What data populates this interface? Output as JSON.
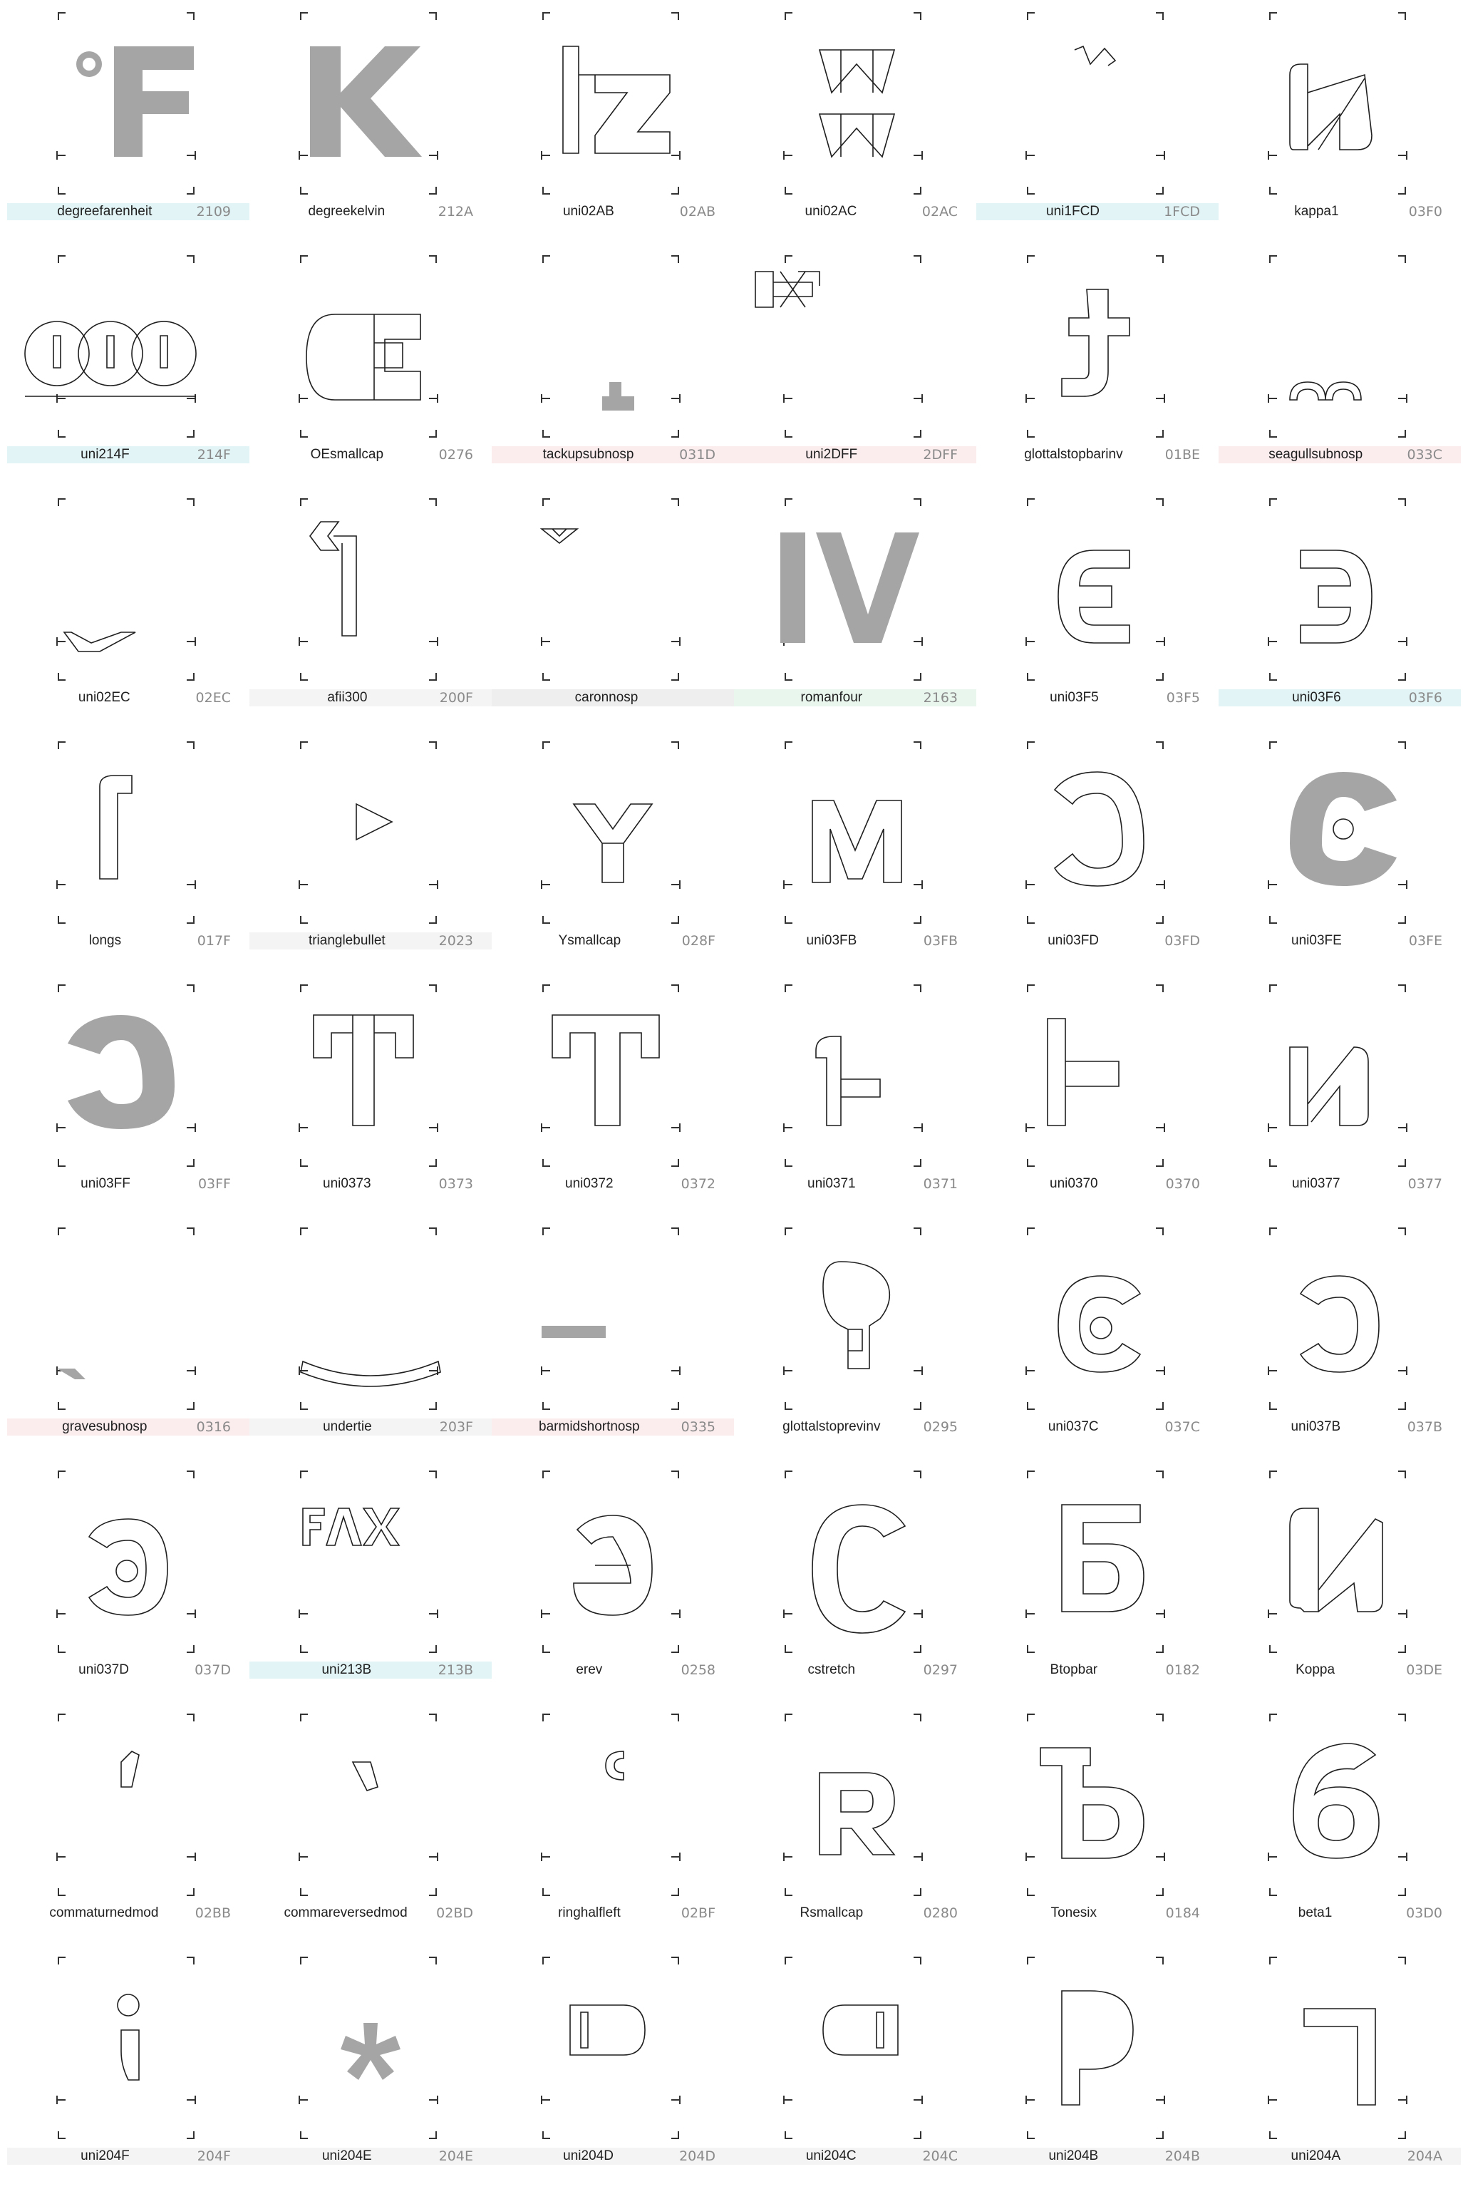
{
  "view": {
    "title": "",
    "accent": "#a5a5a5"
  },
  "colors": {
    "blue": "#e2f4f6",
    "pink": "#fbecee",
    "gray": "#eeeeee",
    "lgray": "#f4f4f4",
    "green": "#e9f6ee",
    "fill_glyph": "#a5a5a5",
    "outline": "#1f1f1f"
  },
  "glyphs": [
    {
      "name": "degreefarenheit",
      "code": "2109",
      "bar": "blue",
      "kind": "fill-F"
    },
    {
      "name": "degreekelvin",
      "code": "212A",
      "bar": "",
      "kind": "fill-K"
    },
    {
      "name": "uni02AB",
      "code": "02AB",
      "bar": "",
      "kind": "outline-lz"
    },
    {
      "name": "uni02AC",
      "code": "02AC",
      "bar": "",
      "kind": "outline-ww"
    },
    {
      "name": "uni1FCD",
      "code": "1FCD",
      "bar": "blue",
      "kind": "outline-accent"
    },
    {
      "name": "kappa1",
      "code": "03F0",
      "bar": "",
      "kind": "outline-kappa"
    },
    {
      "name": "uni214F",
      "code": "214F",
      "bar": "blue",
      "kind": "outline-000"
    },
    {
      "name": "OEsmallcap",
      "code": "0276",
      "bar": "",
      "kind": "outline-oe"
    },
    {
      "name": "tackupsubnosp",
      "code": "031D",
      "bar": "pink",
      "kind": "fill-tack"
    },
    {
      "name": "uni2DFF",
      "code": "2DFF",
      "bar": "pink",
      "kind": "outline-ligature"
    },
    {
      "name": "glottalstopbarinv",
      "code": "01BE",
      "bar": "",
      "kind": "outline-glottalinv"
    },
    {
      "name": "seagullsubnosp",
      "code": "033C",
      "bar": "pink",
      "kind": "outline-seagull"
    },
    {
      "name": "uni02EC",
      "code": "02EC",
      "bar": "",
      "kind": "outline-vlow"
    },
    {
      "name": "afii300",
      "code": "200F",
      "bar": "lgray",
      "kind": "outline-arrowflag"
    },
    {
      "name": "caronnosp",
      "code": "",
      "bar": "gray",
      "kind": "outline-caron"
    },
    {
      "name": "romanfour",
      "code": "2163",
      "bar": "green",
      "kind": "fill-IV"
    },
    {
      "name": "uni03F5",
      "code": "03F5",
      "bar": "",
      "kind": "outline-epsilon"
    },
    {
      "name": "uni03F6",
      "code": "03F6",
      "bar": "blue",
      "kind": "outline-revepsilon"
    },
    {
      "name": "longs",
      "code": "017F",
      "bar": "",
      "kind": "outline-longs"
    },
    {
      "name": "trianglebullet",
      "code": "2023",
      "bar": "lgray",
      "kind": "outline-triangle"
    },
    {
      "name": "Ysmallcap",
      "code": "028F",
      "bar": "",
      "kind": "outline-Y"
    },
    {
      "name": "uni03FB",
      "code": "03FB",
      "bar": "",
      "kind": "outline-M"
    },
    {
      "name": "uni03FD",
      "code": "03FD",
      "bar": "",
      "kind": "outline-revC"
    },
    {
      "name": "uni03FE",
      "code": "03FE",
      "bar": "",
      "kind": "fill-Cdot"
    },
    {
      "name": "uni03FF",
      "code": "03FF",
      "bar": "",
      "kind": "fill-revCdot"
    },
    {
      "name": "uni0373",
      "code": "0373",
      "bar": "",
      "kind": "outline-T3"
    },
    {
      "name": "uni0372",
      "code": "0372",
      "bar": "",
      "kind": "outline-T3b"
    },
    {
      "name": "uni0371",
      "code": "0371",
      "bar": "",
      "kind": "outline-heta"
    },
    {
      "name": "uni0370",
      "code": "0370",
      "bar": "",
      "kind": "outline-Heta"
    },
    {
      "name": "uni0377",
      "code": "0377",
      "bar": "",
      "kind": "outline-kappa2"
    },
    {
      "name": "gravesubnosp",
      "code": "0316",
      "bar": "pink",
      "kind": "fill-grave"
    },
    {
      "name": "undertie",
      "code": "203F",
      "bar": "lgray",
      "kind": "outline-undertie"
    },
    {
      "name": "barmidshortnosp",
      "code": "0335",
      "bar": "pink",
      "kind": "fill-bar"
    },
    {
      "name": "glottalstoprevinv",
      "code": "0295",
      "bar": "",
      "kind": "outline-glottalrev"
    },
    {
      "name": "uni037C",
      "code": "037C",
      "bar": "",
      "kind": "outline-cdot"
    },
    {
      "name": "uni037B",
      "code": "037B",
      "bar": "",
      "kind": "outline-revc"
    },
    {
      "name": "uni037D",
      "code": "037D",
      "bar": "",
      "kind": "outline-revcdot"
    },
    {
      "name": "uni213B",
      "code": "213B",
      "bar": "blue",
      "kind": "outline-fax"
    },
    {
      "name": "erev",
      "code": "0258",
      "bar": "",
      "kind": "outline-erev"
    },
    {
      "name": "cstretch",
      "code": "0297",
      "bar": "",
      "kind": "outline-cstretch"
    },
    {
      "name": "Btopbar",
      "code": "0182",
      "bar": "",
      "kind": "outline-Btopbar"
    },
    {
      "name": "Koppa",
      "code": "03DE",
      "bar": "",
      "kind": "outline-koppa"
    },
    {
      "name": "commaturnedmod",
      "code": "02BB",
      "bar": "",
      "kind": "outline-comma"
    },
    {
      "name": "commareversedmod",
      "code": "02BD",
      "bar": "",
      "kind": "outline-commarev"
    },
    {
      "name": "ringhalfleft",
      "code": "02BF",
      "bar": "",
      "kind": "outline-ringhalf"
    },
    {
      "name": "Rsmallcap",
      "code": "0280",
      "bar": "",
      "kind": "outline-R"
    },
    {
      "name": "Tonesix",
      "code": "0184",
      "bar": "",
      "kind": "outline-tonesix"
    },
    {
      "name": "beta1",
      "code": "03D0",
      "bar": "",
      "kind": "outline-beta"
    },
    {
      "name": "uni204F",
      "code": "204F",
      "bar": "lgray",
      "kind": "outline-semicolonrev"
    },
    {
      "name": "uni204E",
      "code": "204E",
      "bar": "lgray",
      "kind": "fill-asterisk"
    },
    {
      "name": "uni204D",
      "code": "204D",
      "bar": "lgray",
      "kind": "outline-bulletright"
    },
    {
      "name": "uni204C",
      "code": "204C",
      "bar": "lgray",
      "kind": "outline-bulletleft"
    },
    {
      "name": "uni204B",
      "code": "204B",
      "bar": "lgray",
      "kind": "outline-pilcrowrev"
    },
    {
      "name": "uni204A",
      "code": "204A",
      "bar": "lgray",
      "kind": "outline-tironian"
    }
  ]
}
